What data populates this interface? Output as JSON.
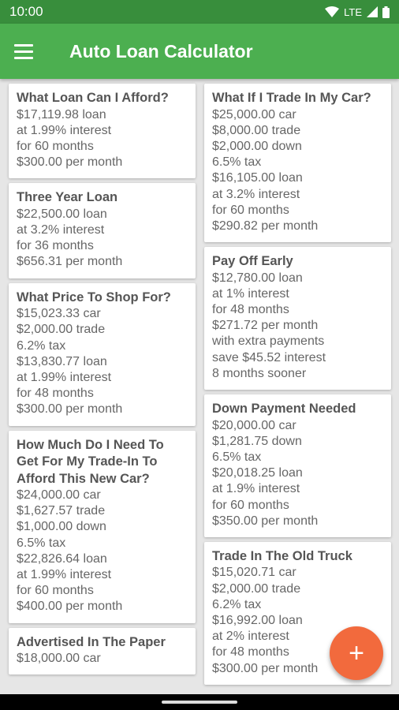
{
  "status_bar": {
    "time": "10:00",
    "network": "LTE"
  },
  "app_bar": {
    "title": "Auto Loan Calculator",
    "menu_icon": "hamburger-menu-icon"
  },
  "left_cards": [
    {
      "title": "What Loan Can I Afford?",
      "lines": [
        "$17,119.98 loan",
        "at 1.99% interest",
        "for 60 months",
        "$300.00 per month"
      ]
    },
    {
      "title": "Three Year Loan",
      "lines": [
        "$22,500.00 loan",
        "at 3.2% interest",
        "for 36 months",
        "$656.31 per month"
      ]
    },
    {
      "title": "What Price To Shop For?",
      "lines": [
        "$15,023.33 car",
        "$2,000.00 trade",
        "6.2% tax",
        "$13,830.77 loan",
        "at 1.99% interest",
        "for 48 months",
        "$300.00 per month"
      ]
    },
    {
      "title": "How Much Do I Need To Get For My Trade-In To Afford This New Car?",
      "lines": [
        "$24,000.00 car",
        "$1,627.57 trade",
        "$1,000.00 down",
        "6.5% tax",
        "$22,826.64 loan",
        "at 1.99% interest",
        "for 60 months",
        "$400.00 per month"
      ]
    },
    {
      "title": "Advertised In The Paper",
      "lines": [
        "$18,000.00 car"
      ]
    }
  ],
  "right_cards": [
    {
      "title": "What If I Trade In My Car?",
      "lines": [
        "$25,000.00 car",
        "$8,000.00 trade",
        "$2,000.00 down",
        "6.5% tax",
        "$16,105.00 loan",
        "at 3.2% interest",
        "for 60 months",
        "$290.82 per month"
      ]
    },
    {
      "title": "Pay Off Early",
      "lines": [
        "$12,780.00 loan",
        "at 1% interest",
        "for 48 months",
        "$271.72 per month",
        "with extra payments",
        "save $45.52 interest",
        "8 months sooner"
      ]
    },
    {
      "title": "Down Payment Needed",
      "lines": [
        "$20,000.00 car",
        "$1,281.75 down",
        "6.5% tax",
        "$20,018.25 loan",
        "at 1.9% interest",
        "for 60 months",
        "$350.00 per month"
      ]
    },
    {
      "title": "Trade In The Old Truck",
      "lines": [
        "$15,020.71 car",
        "$2,000.00 trade",
        "6.2% tax",
        "$16,992.00 loan",
        "at 2% interest",
        "for 48 months",
        "$300.00 per month"
      ]
    }
  ],
  "fab": {
    "icon": "plus-icon",
    "label": "+",
    "color": "#f26a3d"
  },
  "colors": {
    "app_bar": "#4caf50",
    "status_bar": "#388e3c",
    "background": "#e6e6e6"
  }
}
